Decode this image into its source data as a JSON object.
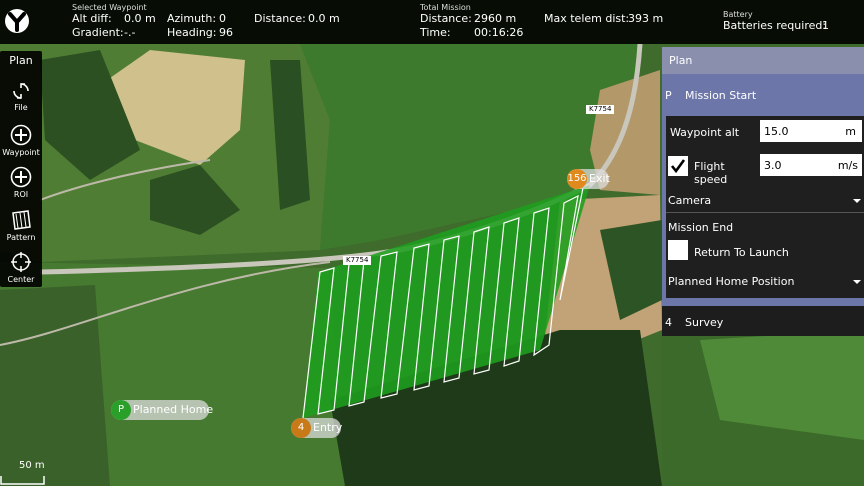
{
  "top": {
    "selected_caption": "Selected Waypoint",
    "alt_diff_label": "Alt diff:",
    "alt_diff_value": "0.0 m",
    "gradient_label": "Gradient:",
    "gradient_value": "-.-",
    "azimuth_label": "Azimuth:",
    "azimuth_value": "0",
    "heading_label": "Heading:",
    "heading_value": "96",
    "distance_label": "Distance:",
    "distance_value": "0.0 m",
    "total_caption": "Total Mission",
    "total_distance_label": "Distance:",
    "total_distance_value": "2960 m",
    "time_label": "Time:",
    "time_value": "00:16:26",
    "max_telem_label": "Max telem dist:",
    "max_telem_value": "393 m",
    "battery_caption": "Battery",
    "batteries_label": "Batteries required:",
    "batteries_value": "1"
  },
  "toolstrip": {
    "title": "Plan",
    "tools": [
      {
        "label": "File",
        "icon": "file-sync-icon"
      },
      {
        "label": "Waypoint",
        "icon": "plus-circle-icon"
      },
      {
        "label": "ROI",
        "icon": "plus-circle-icon"
      },
      {
        "label": "Pattern",
        "icon": "pattern-icon"
      },
      {
        "label": "Center",
        "icon": "crosshair-icon"
      }
    ]
  },
  "plan": {
    "header": "Plan",
    "mission_start": {
      "index": "P",
      "label": "Mission Start"
    },
    "waypoint_alt": {
      "label": "Waypoint alt",
      "value": "15.0",
      "unit": "m"
    },
    "flight_speed": {
      "label": "Flight speed",
      "value": "3.0",
      "unit": "m/s",
      "checked": true
    },
    "camera": "Camera",
    "mission_end": "Mission End",
    "return_to_launch": {
      "label": "Return To Launch",
      "checked": false
    },
    "planned_home": "Planned Home Position",
    "survey": {
      "index": "4",
      "label": "Survey"
    }
  },
  "map": {
    "road_labels": [
      "K7754",
      "K7754"
    ],
    "exit": {
      "index": "156",
      "label": "Exit"
    },
    "entry": {
      "index": "4",
      "label": "Entry"
    },
    "home": {
      "index": "P",
      "label": "Planned Home"
    },
    "scale": "50 m"
  },
  "colors": {
    "survey_fill": "#1e9e1e",
    "exit_badge": "#e08a1e",
    "entry_badge": "#c87a18",
    "home_badge": "#2aa02a",
    "panel_header": "#8a8fae",
    "panel_body": "#6d76a8"
  }
}
